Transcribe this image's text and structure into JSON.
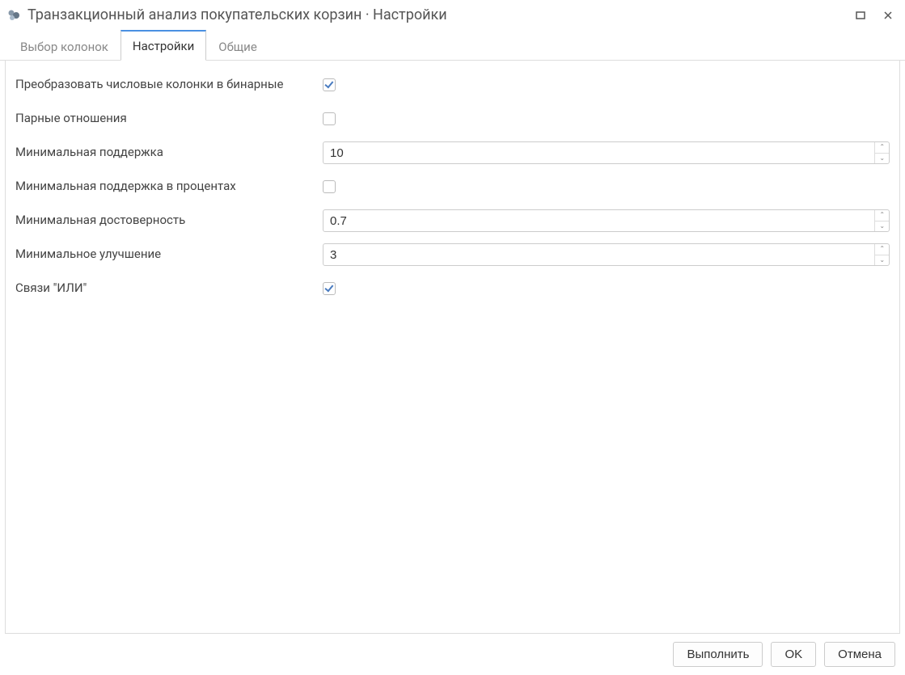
{
  "window": {
    "title": "Транзакционный анализ покупательских корзин · Настройки"
  },
  "tabs": {
    "columns": "Выбор колонок",
    "settings": "Настройки",
    "common": "Общие"
  },
  "settings": {
    "convert_numeric_to_binary": {
      "label": "Преобразовать числовые колонки в бинарные",
      "checked": true
    },
    "paired_relations": {
      "label": "Парные отношения",
      "checked": false
    },
    "min_support": {
      "label": "Минимальная поддержка",
      "value": "10"
    },
    "min_support_percent": {
      "label": "Минимальная поддержка в процентах",
      "checked": false
    },
    "min_confidence": {
      "label": "Минимальная достоверность",
      "value": "0.7"
    },
    "min_improvement": {
      "label": "Минимальное улучшение",
      "value": "3"
    },
    "or_links": {
      "label": "Связи \"ИЛИ\"",
      "checked": true
    }
  },
  "buttons": {
    "run": "Выполнить",
    "ok": "OK",
    "cancel": "Отмена"
  }
}
